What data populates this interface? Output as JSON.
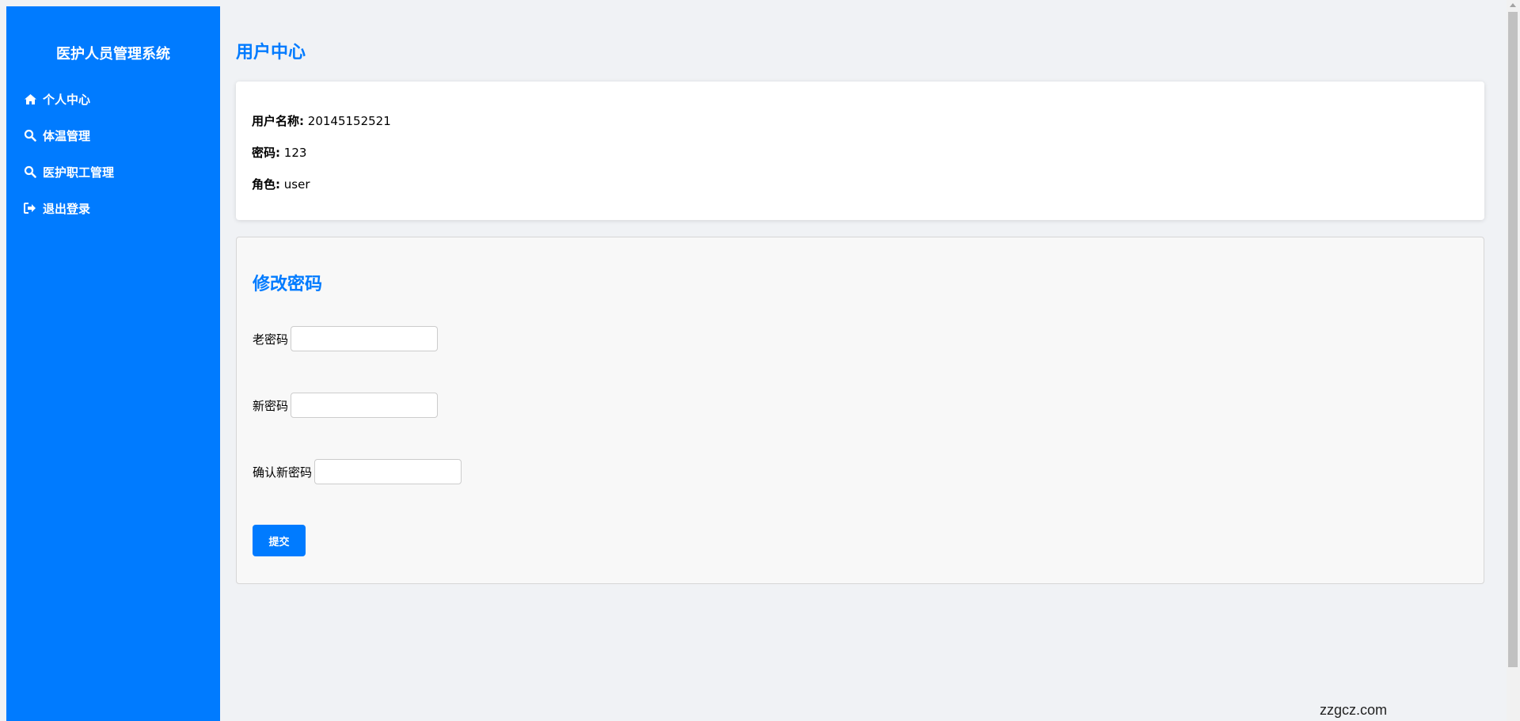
{
  "sidebar": {
    "title": "医护人员管理系统",
    "items": [
      {
        "label": "个人中心",
        "icon": "home-icon"
      },
      {
        "label": "体温管理",
        "icon": "search-icon"
      },
      {
        "label": "医护职工管理",
        "icon": "search-icon"
      },
      {
        "label": "退出登录",
        "icon": "sign-out-icon"
      }
    ]
  },
  "main": {
    "title": "用户中心",
    "user_info": {
      "username_label": "用户名称:",
      "username_value": "20145152521",
      "password_label": "密码:",
      "password_value": "123",
      "role_label": "角色:",
      "role_value": "user"
    },
    "change_password": {
      "title": "修改密码",
      "old_label": "老密码",
      "old_value": "",
      "new_label": "新密码",
      "new_value": "",
      "confirm_label": "确认新密码",
      "confirm_value": "",
      "submit_label": "提交"
    }
  },
  "watermark": "zzgcz.com",
  "colors": {
    "accent": "#007bff",
    "background": "#f0f2f5"
  }
}
